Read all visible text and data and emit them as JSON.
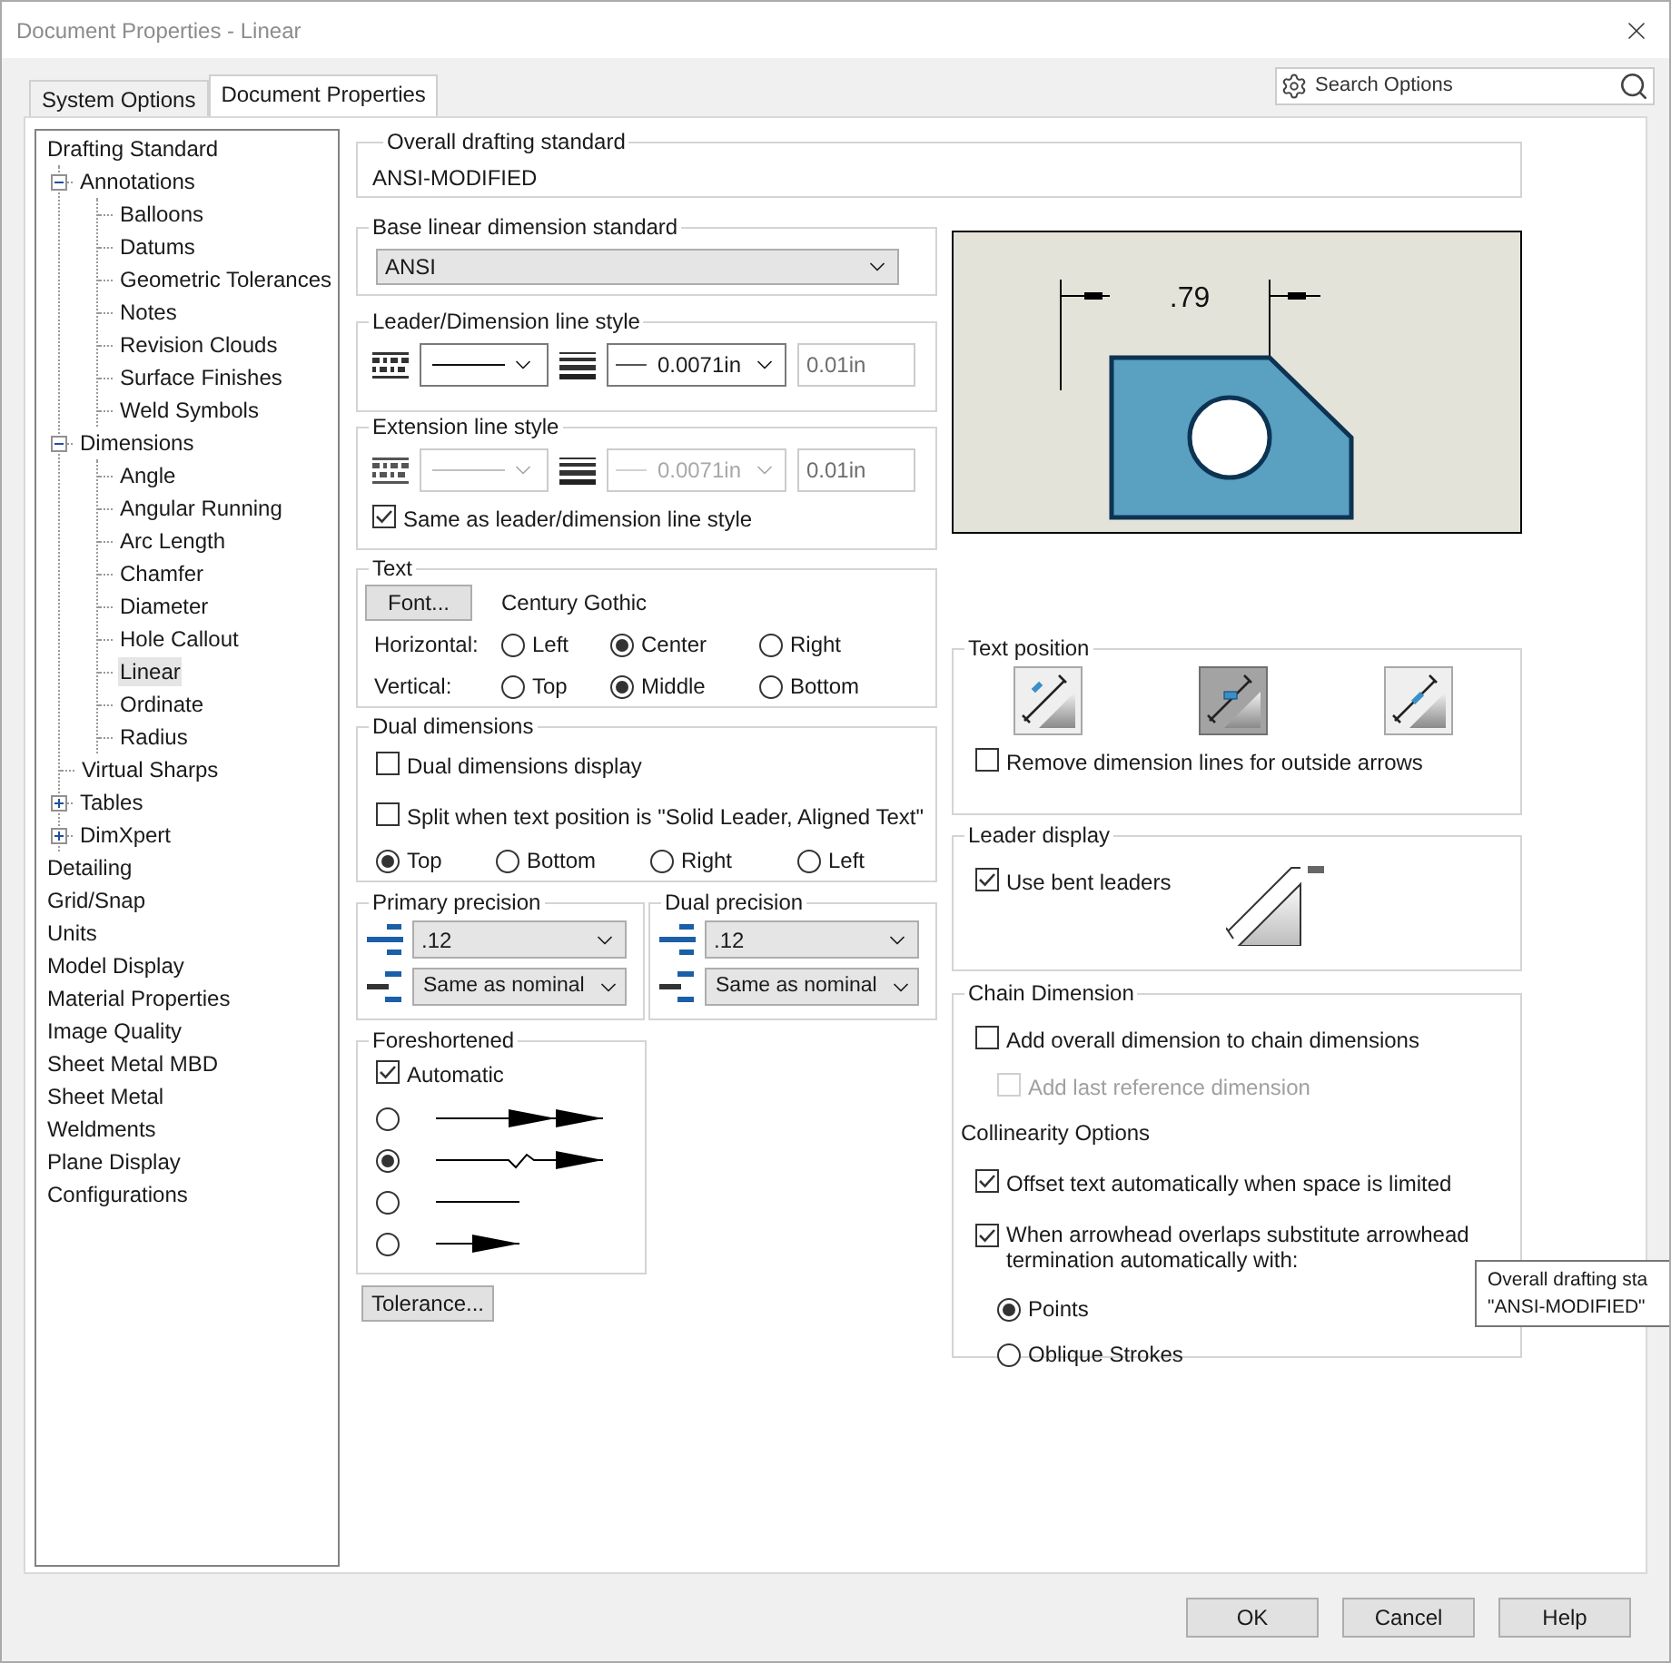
{
  "window": {
    "title": "Document Properties - Linear"
  },
  "tabs": [
    {
      "label": "System Options",
      "selected": false
    },
    {
      "label": "Document Properties",
      "selected": true
    }
  ],
  "search": {
    "placeholder": "Search Options"
  },
  "tree": [
    {
      "label": "Drafting Standard",
      "selected": false,
      "children": [
        {
          "label": "Annotations",
          "selected": false,
          "expanded": true,
          "children": [
            {
              "label": "Balloons",
              "selected": false
            },
            {
              "label": "Datums",
              "selected": false
            },
            {
              "label": "Geometric Tolerances",
              "selected": false
            },
            {
              "label": "Notes",
              "selected": false
            },
            {
              "label": "Revision Clouds",
              "selected": false
            },
            {
              "label": "Surface Finishes",
              "selected": false
            },
            {
              "label": "Weld Symbols",
              "selected": false
            }
          ]
        },
        {
          "label": "Dimensions",
          "selected": false,
          "expanded": true,
          "children": [
            {
              "label": "Angle",
              "selected": false
            },
            {
              "label": "Angular Running",
              "selected": false
            },
            {
              "label": "Arc Length",
              "selected": false
            },
            {
              "label": "Chamfer",
              "selected": false
            },
            {
              "label": "Diameter",
              "selected": false
            },
            {
              "label": "Hole Callout",
              "selected": false
            },
            {
              "label": "Linear",
              "selected": true
            },
            {
              "label": "Ordinate",
              "selected": false
            },
            {
              "label": "Radius",
              "selected": false
            }
          ]
        },
        {
          "label": "Virtual Sharps",
          "selected": false
        },
        {
          "label": "Tables",
          "selected": false,
          "expanded": false
        },
        {
          "label": "DimXpert",
          "selected": false,
          "expanded": false
        }
      ]
    },
    {
      "label": "Detailing",
      "selected": false
    },
    {
      "label": "Grid/Snap",
      "selected": false
    },
    {
      "label": "Units",
      "selected": false
    },
    {
      "label": "Model Display",
      "selected": false
    },
    {
      "label": "Material Properties",
      "selected": false
    },
    {
      "label": "Image Quality",
      "selected": false
    },
    {
      "label": "Sheet Metal MBD",
      "selected": false
    },
    {
      "label": "Sheet Metal",
      "selected": false
    },
    {
      "label": "Weldments",
      "selected": false
    },
    {
      "label": "Plane Display",
      "selected": false
    },
    {
      "label": "Configurations",
      "selected": false
    }
  ],
  "overall_standard": {
    "label": "Overall drafting standard",
    "value": "ANSI-MODIFIED"
  },
  "base_standard": {
    "label": "Base linear dimension standard",
    "value": "ANSI"
  },
  "line_styles": [
    {
      "label": "Leader/Dimension line style",
      "thickness": "0.0071in",
      "width": "0.01in",
      "disabled": false
    },
    {
      "label": "Extension line style",
      "thickness": "0.0071in",
      "width": "0.01in",
      "disabled": true
    }
  ],
  "same_as_leader": {
    "label": "Same as leader/dimension line style",
    "checked": true
  },
  "text": {
    "label": "Text",
    "font_button": "Font...",
    "font_name": "Century Gothic",
    "rows": [
      {
        "label": "Horizontal:",
        "options": [
          {
            "label": "Left",
            "selected": false
          },
          {
            "label": "Center",
            "selected": true
          },
          {
            "label": "Right",
            "selected": false
          }
        ]
      },
      {
        "label": "Vertical:",
        "options": [
          {
            "label": "Top",
            "selected": false
          },
          {
            "label": "Middle",
            "selected": true
          },
          {
            "label": "Bottom",
            "selected": false
          }
        ]
      }
    ]
  },
  "dual_dimensions": {
    "label": "Dual dimensions",
    "checkboxes": [
      {
        "label": "Dual dimensions display",
        "checked": false
      },
      {
        "label": "Split when text position is \"Solid Leader, Aligned Text\"",
        "checked": false
      }
    ],
    "options": [
      {
        "label": "Top",
        "selected": true
      },
      {
        "label": "Bottom",
        "selected": false
      },
      {
        "label": "Right",
        "selected": false
      },
      {
        "label": "Left",
        "selected": false
      }
    ]
  },
  "precision": [
    {
      "label": "Primary precision",
      "value": ".12",
      "tolerance": "Same as nominal"
    },
    {
      "label": "Dual precision",
      "value": ".12",
      "tolerance": "Same as nominal"
    }
  ],
  "foreshortened": {
    "label": "Foreshortened",
    "automatic": {
      "label": "Automatic",
      "checked": true
    },
    "options": [
      {
        "kind": "double-arrow",
        "selected": false
      },
      {
        "kind": "zigzag",
        "selected": true
      },
      {
        "kind": "line",
        "selected": false
      },
      {
        "kind": "arrow",
        "selected": false
      }
    ]
  },
  "tolerance_button": "Tolerance...",
  "preview": {
    "dimension": ".79"
  },
  "text_position": {
    "label": "Text position",
    "options": [
      {
        "kind": "above",
        "selected": false
      },
      {
        "kind": "broken",
        "selected": true
      },
      {
        "kind": "inline",
        "selected": false
      }
    ],
    "remove_lines": {
      "label": "Remove dimension lines for outside arrows",
      "checked": false
    }
  },
  "leader_display": {
    "label": "Leader display",
    "bent": {
      "label": "Use bent leaders",
      "checked": true
    }
  },
  "chain_dimension": {
    "label": "Chain Dimension",
    "add_overall": {
      "label": "Add overall dimension to chain dimensions",
      "checked": false
    },
    "add_last": {
      "label": "Add last reference dimension",
      "checked": false,
      "disabled": true
    },
    "collinearity_label": "Collinearity Options",
    "offset": {
      "label": "Offset text automatically when space is limited",
      "checked": true
    },
    "substitute": {
      "label": "When arrowhead overlaps substitute arrowhead termination automatically with:",
      "checked": true
    },
    "terminations": [
      {
        "label": "Points",
        "selected": true
      },
      {
        "label": "Oblique Strokes",
        "selected": false
      }
    ]
  },
  "tooltip": {
    "lines": [
      "Overall drafting sta",
      "\"ANSI-MODIFIED\""
    ]
  },
  "buttons": [
    {
      "label": "OK"
    },
    {
      "label": "Cancel"
    },
    {
      "label": "Help"
    }
  ]
}
